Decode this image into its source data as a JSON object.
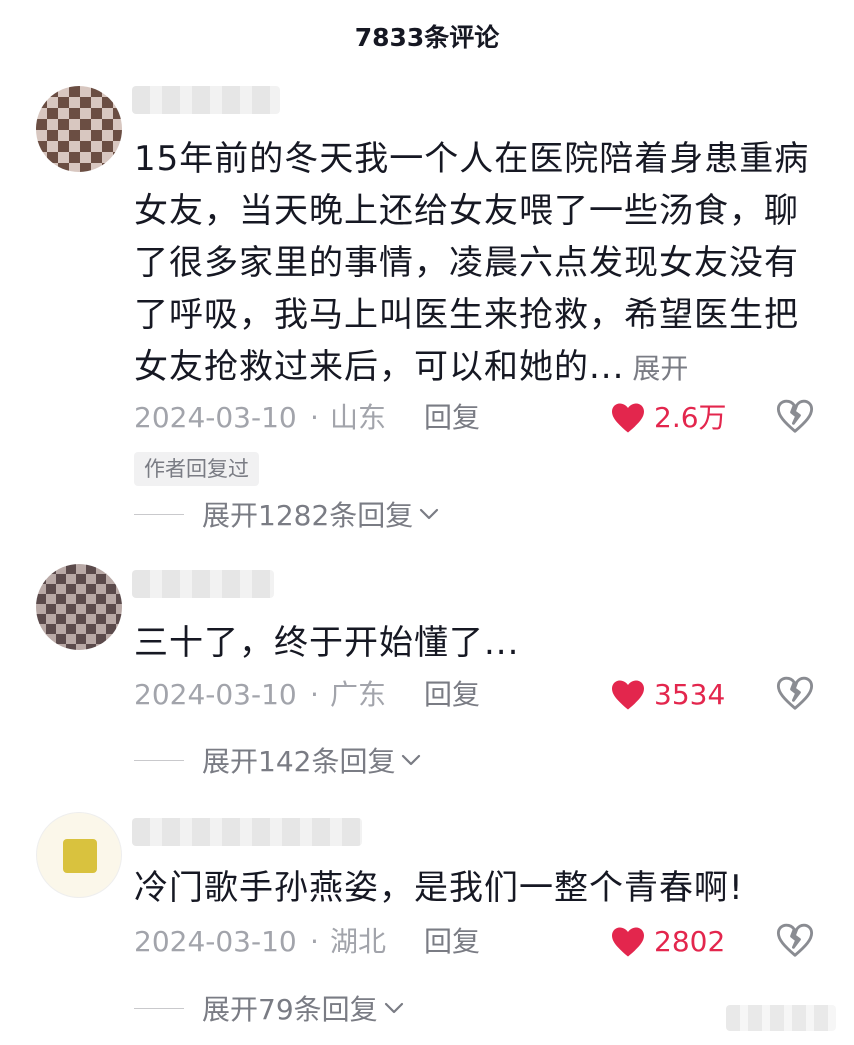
{
  "header": {
    "title": "7833条评论"
  },
  "comments": [
    {
      "text": "15年前的冬天我一个人在医院陪着身患重病女友，当天晚上还给女友喂了一些汤食，聊了很多家里的事情，凌晨六点发现女友没有了呼吸，我马上叫医生来抢救，希望医生把女友抢救过来后，可以和她的...",
      "expand_label": "展开",
      "date": "2024-03-10",
      "separator": "·",
      "location": "山东",
      "reply_label": "回复",
      "likes": "2.6万",
      "author_badge": "作者回复过",
      "replies_label": "展开1282条回复"
    },
    {
      "text": "三十了，终于开始懂了...",
      "date": "2024-03-10",
      "separator": "·",
      "location": "广东",
      "reply_label": "回复",
      "likes": "3534",
      "replies_label": "展开142条回复"
    },
    {
      "text": "冷门歌手孙燕姿，是我们一整个青春啊!",
      "date": "2024-03-10",
      "separator": "·",
      "location": "湖北",
      "reply_label": "回复",
      "likes": "2802",
      "replies_label": "展开79条回复"
    }
  ],
  "icons": {
    "like": "heart-icon",
    "dislike": "broken-heart-icon",
    "expand": "chevron-down-icon"
  },
  "colors": {
    "like": "#e3264d",
    "muted": "#a2a4ab",
    "text": "#161823"
  }
}
